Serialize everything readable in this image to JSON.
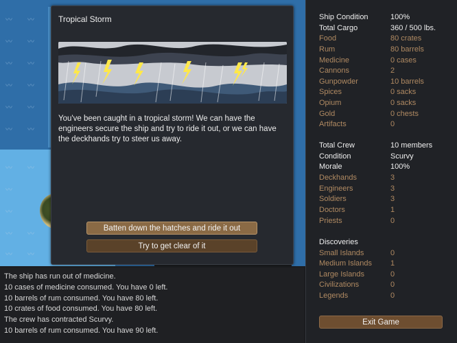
{
  "dialog": {
    "title": "Tropical Storm",
    "body": "You've been caught in a tropical storm! We can have the engineers secure the ship and try to ride it out, or we can have the deckhands try to steer us away.",
    "option_ride": "Batten down the hatches and ride it out",
    "option_clear": "Try to get clear of it"
  },
  "log": [
    "The ship has run out of medicine.",
    "10 cases of medicine consumed. You have 0 left.",
    "10 barrels of rum consumed. You have 80 left.",
    "10 crates of food consumed. You have 80 left.",
    "The crew has contracted Scurvy.",
    "10 barrels of rum consumed. You have 90 left."
  ],
  "ship": {
    "condition_label": "Ship Condition",
    "condition_value": "100%",
    "cargo_label": "Total Cargo",
    "cargo_value": "360 / 500 lbs.",
    "items": [
      {
        "label": "Food",
        "value": "80 crates"
      },
      {
        "label": "Rum",
        "value": "80 barrels"
      },
      {
        "label": "Medicine",
        "value": "0 cases"
      },
      {
        "label": "Cannons",
        "value": "2"
      },
      {
        "label": "Gunpowder",
        "value": "10 barrels"
      },
      {
        "label": "Spices",
        "value": "0 sacks"
      },
      {
        "label": "Opium",
        "value": "0 sacks"
      },
      {
        "label": "Gold",
        "value": "0 chests"
      },
      {
        "label": "Artifacts",
        "value": "0"
      }
    ]
  },
  "crew": {
    "total_label": "Total Crew",
    "total_value": "10 members",
    "condition_label": "Condition",
    "condition_value": "Scurvy",
    "morale_label": "Morale",
    "morale_value": "100%",
    "roles": [
      {
        "label": "Deckhands",
        "value": "3"
      },
      {
        "label": "Engineers",
        "value": "3"
      },
      {
        "label": "Soldiers",
        "value": "3"
      },
      {
        "label": "Doctors",
        "value": "1"
      },
      {
        "label": "Priests",
        "value": "0"
      }
    ]
  },
  "discoveries": {
    "header": "Discoveries",
    "items": [
      {
        "label": "Small Islands",
        "value": "0"
      },
      {
        "label": "Medium Islands",
        "value": "1"
      },
      {
        "label": "Large Islands",
        "value": "0"
      },
      {
        "label": "Civilizations",
        "value": "0"
      },
      {
        "label": "Legends",
        "value": "0"
      }
    ]
  },
  "exit_label": "Exit Game",
  "colors": {
    "deep_water": "#2f6ea8",
    "shallow_water": "#62b0e4",
    "panel_bg": "#202226",
    "sub_text": "#b08a62",
    "button_primary": "#8a6a45",
    "button_secondary": "#5a4229"
  }
}
